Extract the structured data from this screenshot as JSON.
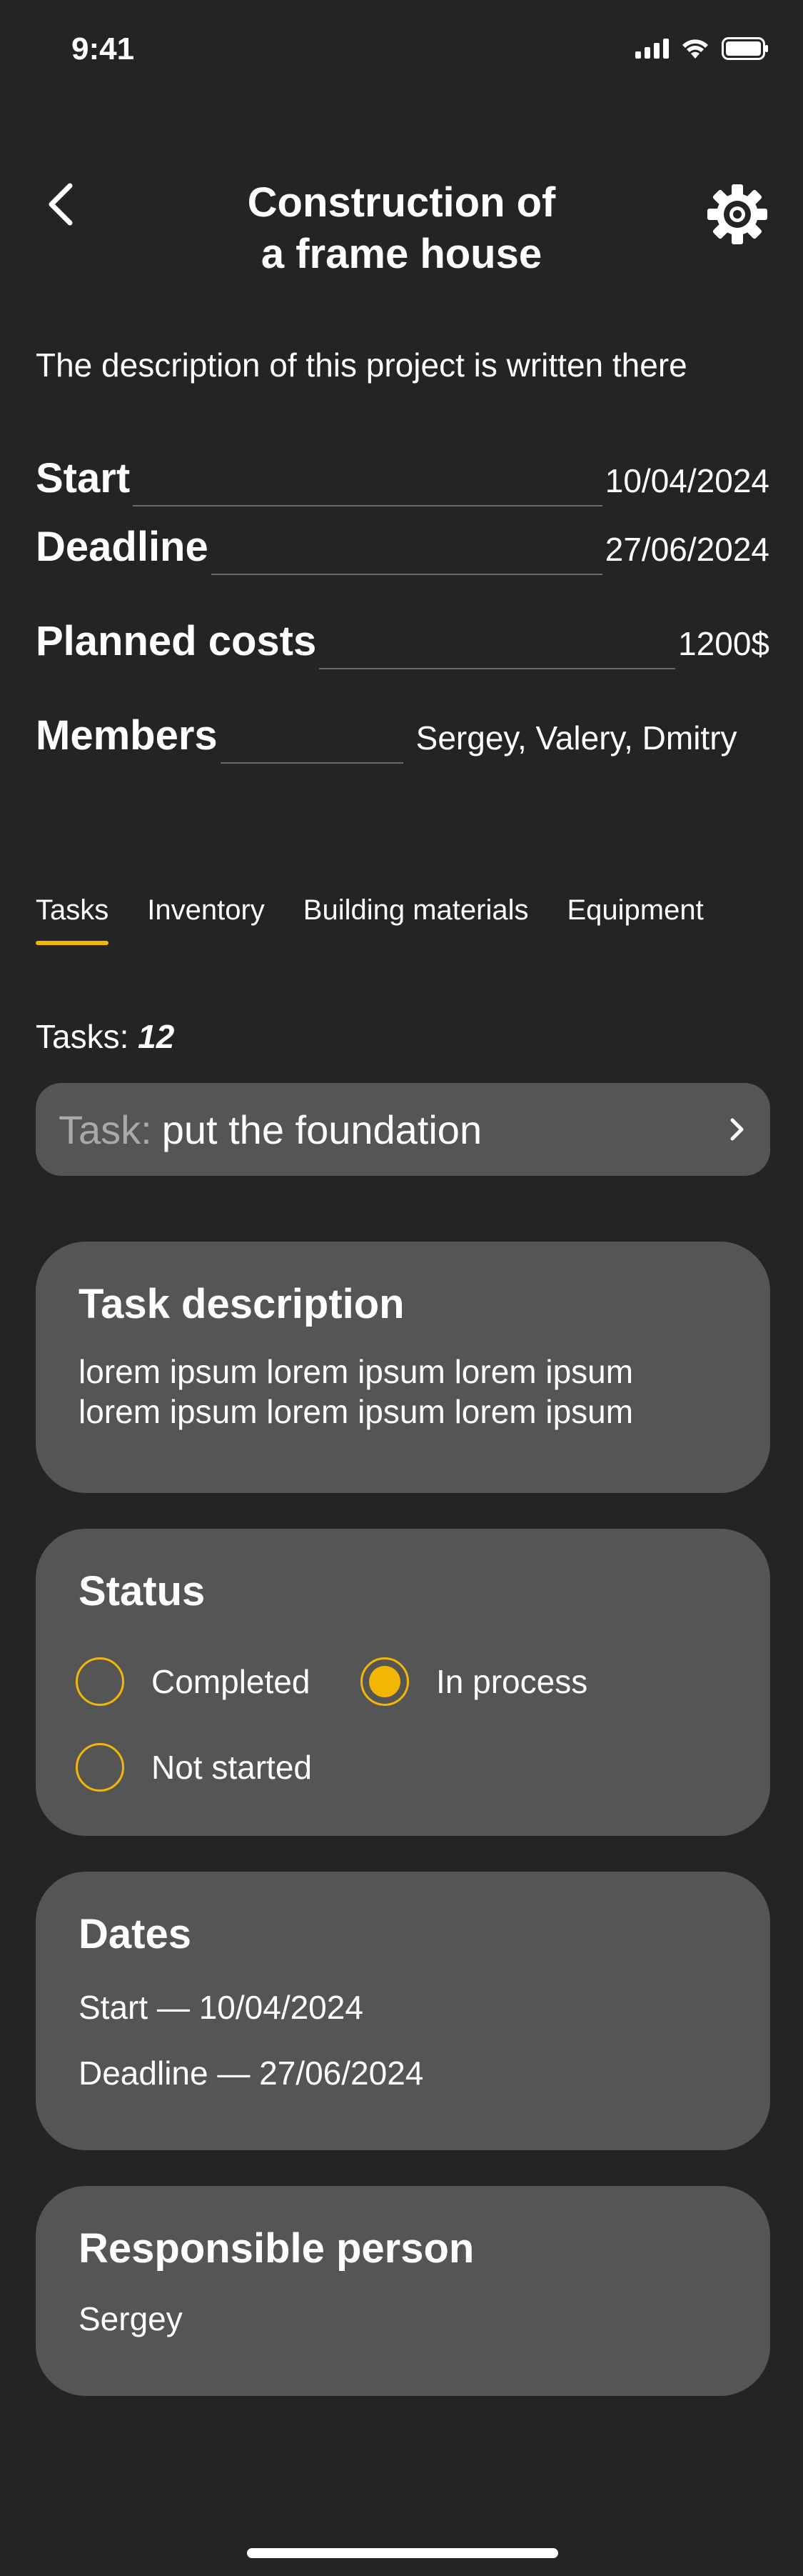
{
  "status_bar": {
    "time": "9:41",
    "icons": [
      "signal-icon",
      "wifi-icon",
      "battery-icon"
    ]
  },
  "header": {
    "title_line1": "Construction of",
    "title_line2": "a frame house",
    "icons": [
      "back-chevron-icon",
      "gear-icon"
    ]
  },
  "project": {
    "description": "The description of this project is written there",
    "start_label": "Start",
    "start_value": "10/04/2024",
    "deadline_label": "Deadline",
    "deadline_value": "27/06/2024",
    "costs_label": "Planned costs",
    "costs_value": "1200$",
    "members_label": "Members",
    "members_value": "Sergey, Valery, Dmitry"
  },
  "tabs": [
    {
      "label": "Tasks",
      "active": true
    },
    {
      "label": "Inventory",
      "active": false
    },
    {
      "label": "Building materials",
      "active": false
    },
    {
      "label": "Equipment",
      "active": false
    }
  ],
  "tasks": {
    "count_label": "Tasks:",
    "count": "12",
    "selected_prefix": "Task:",
    "selected_value": "put the foundation"
  },
  "task_description": {
    "heading": "Task description",
    "line1": "lorem ipsum lorem ipsum lorem ipsum",
    "line2": "lorem ipsum lorem ipsum lorem ipsum"
  },
  "status": {
    "heading": "Status",
    "options": [
      {
        "label": "Completed",
        "selected": false
      },
      {
        "label": "In process",
        "selected": true
      },
      {
        "label": "Not started",
        "selected": false
      }
    ]
  },
  "dates": {
    "heading": "Dates",
    "start": "Start — 10/04/2024",
    "deadline": "Deadline — 27/06/2024"
  },
  "responsible": {
    "heading": "Responsible person",
    "name": "Sergey"
  },
  "colors": {
    "background": "#242424",
    "card": "#555555",
    "accent": "#f2b705"
  }
}
